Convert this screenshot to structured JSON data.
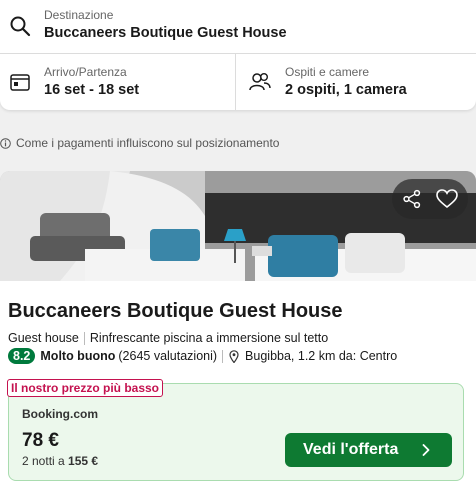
{
  "search": {
    "destination_label": "Destinazione",
    "destination_value": "Buccaneers Boutique Guest House",
    "dates_label": "Arrivo/Partenza",
    "dates_value": "16 set - 18 set",
    "guests_label": "Ospiti e camere",
    "guests_value": "2 ospiti, 1 camera"
  },
  "payment_note": "Come i pagamenti influiscono sul posizionamento",
  "hotel": {
    "name": "Buccaneers Boutique Guest House",
    "type": "Guest house",
    "highlight": "Rinfrescante piscina a immersione sul tetto",
    "rating_score": "8.2",
    "rating_label": "Molto buono",
    "review_count": "(2645 valutazioni)",
    "location": "Bugibba, 1.2 km da: Centro"
  },
  "deal": {
    "badge": "Il nostro prezzo più basso",
    "provider": "Booking.com",
    "price": "78 €",
    "nights_text": "2 notti a",
    "total": "155 €",
    "cta_label": "Vedi l'offerta"
  },
  "colors": {
    "rating_green": "#007a3d",
    "cta_green": "#0e7a32",
    "badge_red": "#c4124f",
    "deal_bg": "#ecf8ec"
  },
  "icons": [
    "search-icon",
    "calendar-icon",
    "guests-icon",
    "info-icon",
    "share-icon",
    "heart-icon",
    "location-pin-icon",
    "chevron-right-icon"
  ]
}
